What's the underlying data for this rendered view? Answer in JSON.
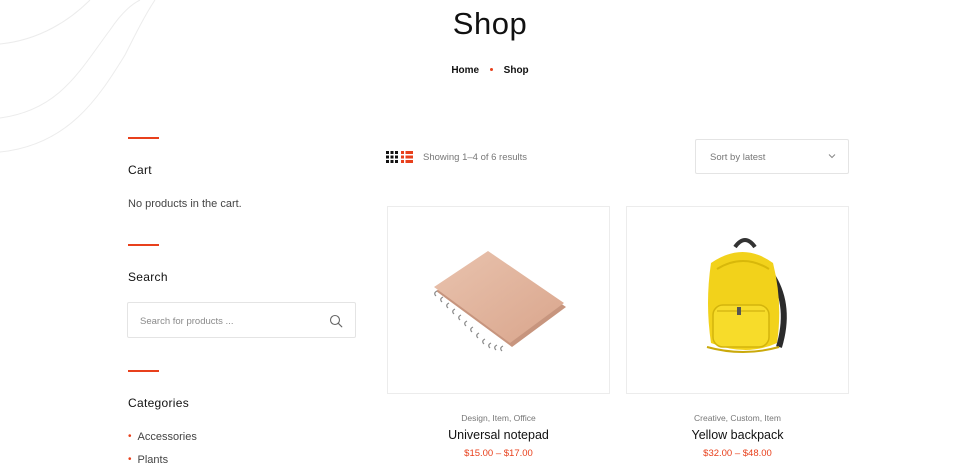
{
  "page": {
    "title": "Shop"
  },
  "breadcrumb": {
    "home": "Home",
    "current": "Shop"
  },
  "sidebar": {
    "cart": {
      "title": "Cart",
      "empty_text": "No products in the cart."
    },
    "search": {
      "title": "Search",
      "placeholder": "Search for products ..."
    },
    "categories": {
      "title": "Categories",
      "items": [
        "Accessories",
        "Plants"
      ]
    }
  },
  "toolbar": {
    "results_text": "Showing 1–4 of 6 results",
    "sort_label": "Sort by latest"
  },
  "products": [
    {
      "categories": "Design, Item, Office",
      "name": "Universal notepad",
      "price": "$15.00 – $17.00"
    },
    {
      "categories": "Creative, Custom, Item",
      "name": "Yellow backpack",
      "price": "$32.00 – $48.00"
    }
  ],
  "colors": {
    "accent": "#e8401c",
    "text": "#111111",
    "muted": "#777777",
    "border": "#e4e4e4"
  }
}
